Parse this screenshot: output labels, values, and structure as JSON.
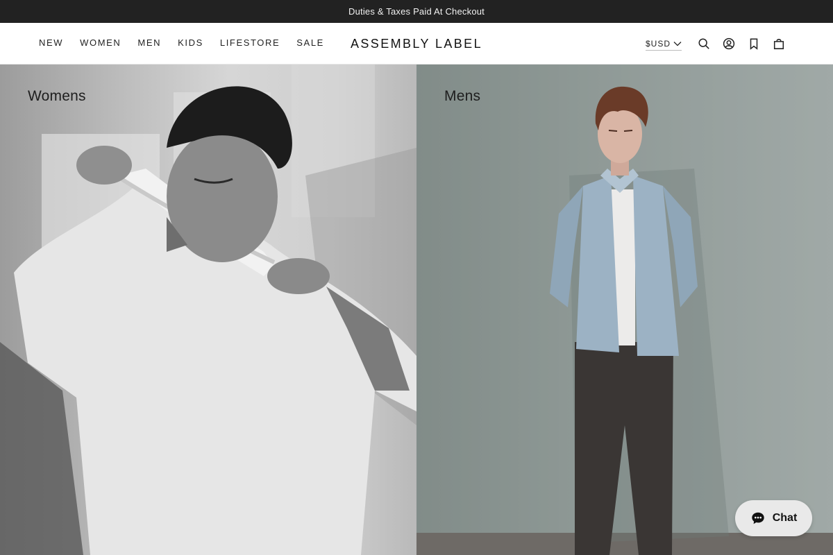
{
  "announcement": {
    "text": "Duties & Taxes Paid At Checkout"
  },
  "header": {
    "nav": [
      "NEW",
      "WOMEN",
      "MEN",
      "KIDS",
      "LIFESTORE",
      "SALE"
    ],
    "logo": "ASSEMBLY LABEL",
    "currency": "$USD",
    "icons": [
      "search-icon",
      "account-icon",
      "bookmark-icon",
      "bag-icon"
    ]
  },
  "hero": {
    "left": {
      "title": "Womens"
    },
    "right": {
      "title": "Mens"
    }
  },
  "chat": {
    "label": "Chat"
  },
  "colors": {
    "announce_bg": "#222222",
    "mens_bg": "#8e9895"
  }
}
